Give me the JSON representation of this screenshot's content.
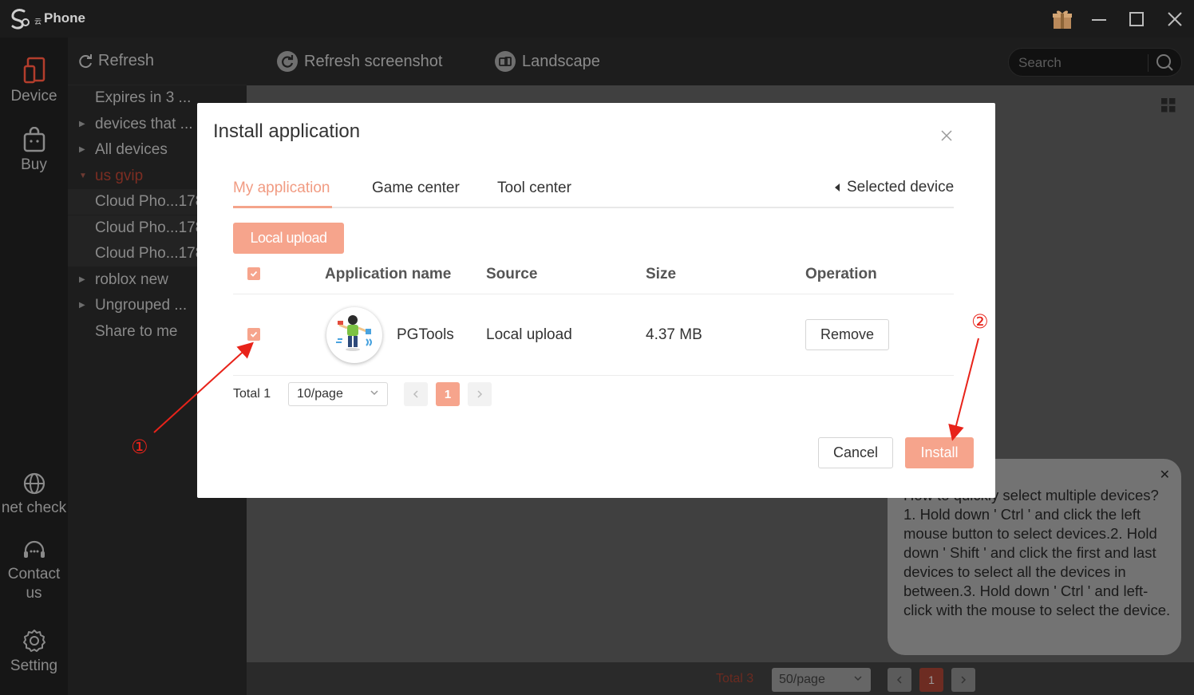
{
  "app": {
    "brand_small": "云",
    "brand": "Phone"
  },
  "nav": {
    "device": "Device",
    "buy": "Buy",
    "net_check": "net check",
    "contact_line1": "Contact",
    "contact_line2": "us",
    "setting": "Setting"
  },
  "group_panel": {
    "refresh": "Refresh",
    "items": [
      {
        "label": "Expires in 3 ..."
      },
      {
        "label": "devices that ..."
      },
      {
        "label": "All devices"
      },
      {
        "label": "us gvip"
      },
      {
        "label": "Cloud Pho...178"
      },
      {
        "label": "Cloud Pho...178"
      },
      {
        "label": "Cloud Pho...178"
      },
      {
        "label": "roblox new"
      },
      {
        "label": "Ungrouped ..."
      },
      {
        "label": "Share to me"
      }
    ]
  },
  "toolbar": {
    "refresh_screenshot": "Refresh screenshot",
    "landscape": "Landscape",
    "search_placeholder": "Search"
  },
  "bottom_bar": {
    "total": "Total 3",
    "page_size": "50/page",
    "current_page": "1"
  },
  "tip": {
    "text": "How to quickly select multiple devices? 1. Hold down ' Ctrl ' and click the left mouse button to select devices.2. Hold down ' Shift ' and click the first and last devices to select all the devices in between.3. Hold down ' Ctrl ' and left-click with the mouse to select the device."
  },
  "modal": {
    "title": "Install application",
    "tabs": [
      "My application",
      "Game center",
      "Tool center"
    ],
    "selected_device": "Selected device",
    "local_upload_button": "Local upload",
    "columns": [
      "Application name",
      "Source",
      "Size",
      "Operation"
    ],
    "rows": [
      {
        "name": "PGTools",
        "source": "Local upload",
        "size": "4.37 MB",
        "operation": "Remove"
      }
    ],
    "total": "Total 1",
    "page_size": "10/page",
    "current_page": "1",
    "cancel": "Cancel",
    "install": "Install"
  },
  "annotations": {
    "step1": "①",
    "step2": "②"
  },
  "colors": {
    "accent": "#f6a48c",
    "dark_bg": "#1d1d1d",
    "annotation_red": "#e8231a"
  }
}
